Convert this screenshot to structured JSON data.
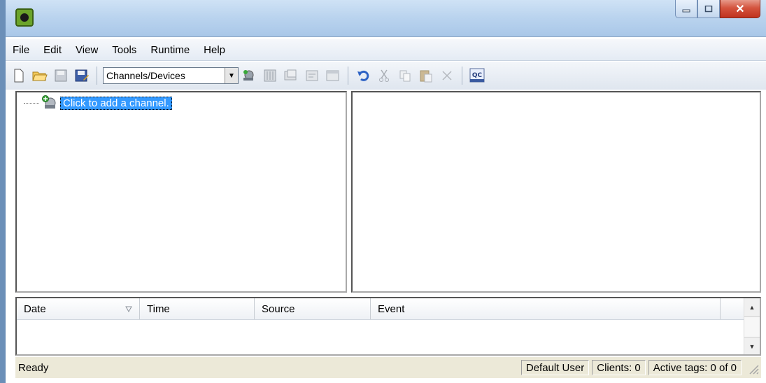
{
  "window": {
    "title": ""
  },
  "menu": [
    "File",
    "Edit",
    "View",
    "Tools",
    "Runtime",
    "Help"
  ],
  "toolbar": {
    "view_combo_value": "Channels/Devices",
    "qc_label": "QC"
  },
  "tree": {
    "add_channel_label": "Click to add a channel."
  },
  "event_log": {
    "columns": [
      "Date",
      "Time",
      "Source",
      "Event"
    ]
  },
  "status": {
    "ready": "Ready",
    "user": "Default User",
    "clients": "Clients: 0",
    "active_tags": "Active tags: 0 of 0"
  },
  "colors": {
    "selection": "#3399ff",
    "close_button": "#c0321e",
    "title_bar": "#b9d3ee"
  }
}
